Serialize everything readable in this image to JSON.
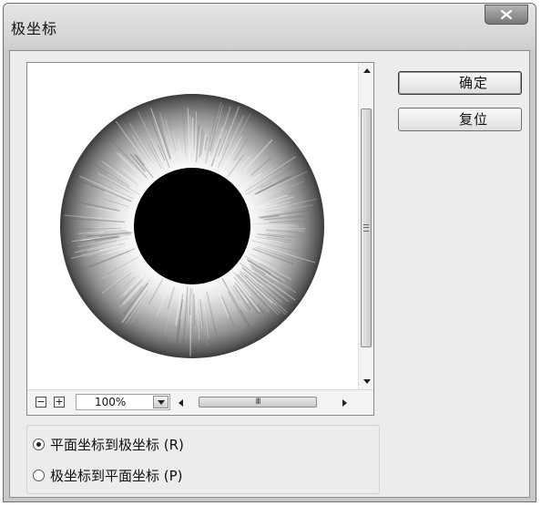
{
  "window": {
    "title": "极坐标",
    "close_label": "x"
  },
  "preview": {
    "zoom_minus": "−",
    "zoom_plus": "+",
    "zoom_value": "100%",
    "hscroll_grip": "III"
  },
  "buttons": {
    "ok_label": "确定",
    "reset_label": "复位"
  },
  "options": [
    {
      "label": "平面坐标到极坐标 (R)",
      "checked": true
    },
    {
      "label": "极坐标到平面坐标 (P)",
      "checked": false
    }
  ],
  "icons": [
    "close-icon",
    "scroll-up-arrow-icon",
    "scroll-down-arrow-icon",
    "scroll-left-arrow-icon",
    "scroll-right-arrow-icon",
    "dropdown-arrow-icon",
    "polar-preview-image"
  ]
}
